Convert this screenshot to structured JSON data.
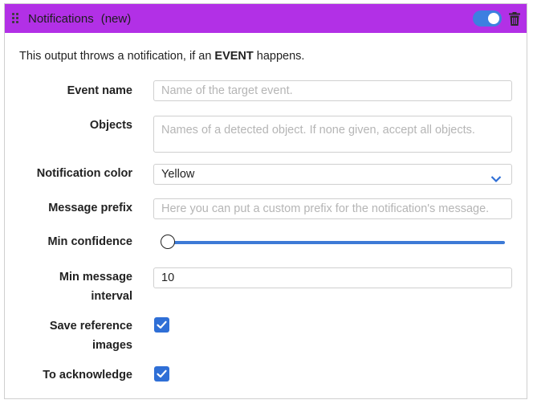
{
  "header": {
    "title": "Notifications",
    "tag": "(new)",
    "accent_color": "#b230e6",
    "toggle_on": true,
    "toggle_color": "#3d7fe0",
    "icons": [
      "drag-handle-icon",
      "trash-icon"
    ]
  },
  "intro": {
    "text_before": "This output throws a notification, if an ",
    "emphasis": "EVENT",
    "text_after": " happens."
  },
  "fields": {
    "event_name": {
      "label": "Event name",
      "value": "",
      "placeholder": "Name of the target event."
    },
    "objects": {
      "label": "Objects",
      "value": "",
      "placeholder": "Names of a detected object. If none given, accept all objects."
    },
    "notification_color": {
      "label": "Notification color",
      "value": "Yellow"
    },
    "message_prefix": {
      "label": "Message prefix",
      "value": "",
      "placeholder": "Here you can put a custom prefix for the notification's message."
    },
    "min_confidence": {
      "label": "Min confidence",
      "value": 0.0
    },
    "min_message_interval": {
      "label_line1": "Min message",
      "label_line2": "interval",
      "value": "10"
    },
    "save_reference_images": {
      "label_line1": "Save reference",
      "label_line2": "images",
      "checked": true
    },
    "to_acknowledge": {
      "label": "To acknowledge",
      "checked": true
    }
  },
  "colors": {
    "checkbox": "#2f6fd6",
    "slider": "#3d7ad6"
  }
}
